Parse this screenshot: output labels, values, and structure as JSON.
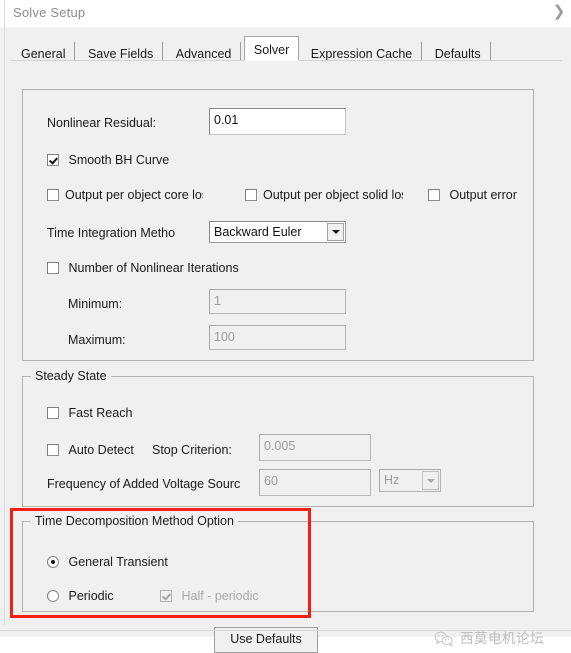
{
  "window": {
    "title": "Solve Setup",
    "expand_icon": "chevron-right-icon"
  },
  "tabs": [
    {
      "label": "General",
      "active": false
    },
    {
      "label": "Save Fields",
      "active": false
    },
    {
      "label": "Advanced",
      "active": false
    },
    {
      "label": "Solver",
      "active": true
    },
    {
      "label": "Expression Cache",
      "active": false
    },
    {
      "label": "Defaults",
      "active": false
    }
  ],
  "solver": {
    "nonlinear_residual": {
      "label": "Nonlinear Residual:",
      "value": "0.01"
    },
    "smooth_bh_curve": {
      "label": "Smooth BH Curve",
      "checked": true
    },
    "output_checkboxes": [
      {
        "label": "Output per object core loss",
        "checked": false
      },
      {
        "label": "Output per object solid loss",
        "checked": false
      },
      {
        "label": "Output error",
        "checked": false
      }
    ],
    "time_integration": {
      "label": "Time Integration Metho",
      "value": "Backward Euler",
      "dropdown_icon": "chevron-down-icon"
    },
    "nonlinear_iterations": {
      "label": "Number of Nonlinear Iterations",
      "checked": false,
      "minimum_label": "Minimum:",
      "minimum_value": "1",
      "maximum_label": "Maximum:",
      "maximum_value": "100"
    }
  },
  "steady_state": {
    "legend": "Steady State",
    "fast_reach": {
      "label": "Fast Reach",
      "checked": false
    },
    "auto_detect": {
      "label": "Auto Detect",
      "checked": false
    },
    "stop_criterion": {
      "label": "Stop Criterion:",
      "value": "0.005"
    },
    "frequency": {
      "label": "Frequency of Added Voltage Sourc",
      "value": "60",
      "unit": "Hz",
      "unit_dropdown_icon": "chevron-down-icon"
    }
  },
  "time_decomposition": {
    "legend": "Time Decomposition Method Option",
    "options": [
      {
        "label": "General Transient",
        "selected": true
      },
      {
        "label": "Periodic",
        "selected": false
      }
    ],
    "half_periodic": {
      "label": "Half - periodic",
      "checked": true,
      "disabled": true
    }
  },
  "footer": {
    "use_defaults_label": "Use Defaults",
    "watermark_text": "西莫电机论坛",
    "watermark_icon": "wechat-icon"
  },
  "colors": {
    "annotation_red": "#f31f12",
    "panel_background": "#f0f0f0",
    "disabled_text": "#9b9b9b"
  }
}
